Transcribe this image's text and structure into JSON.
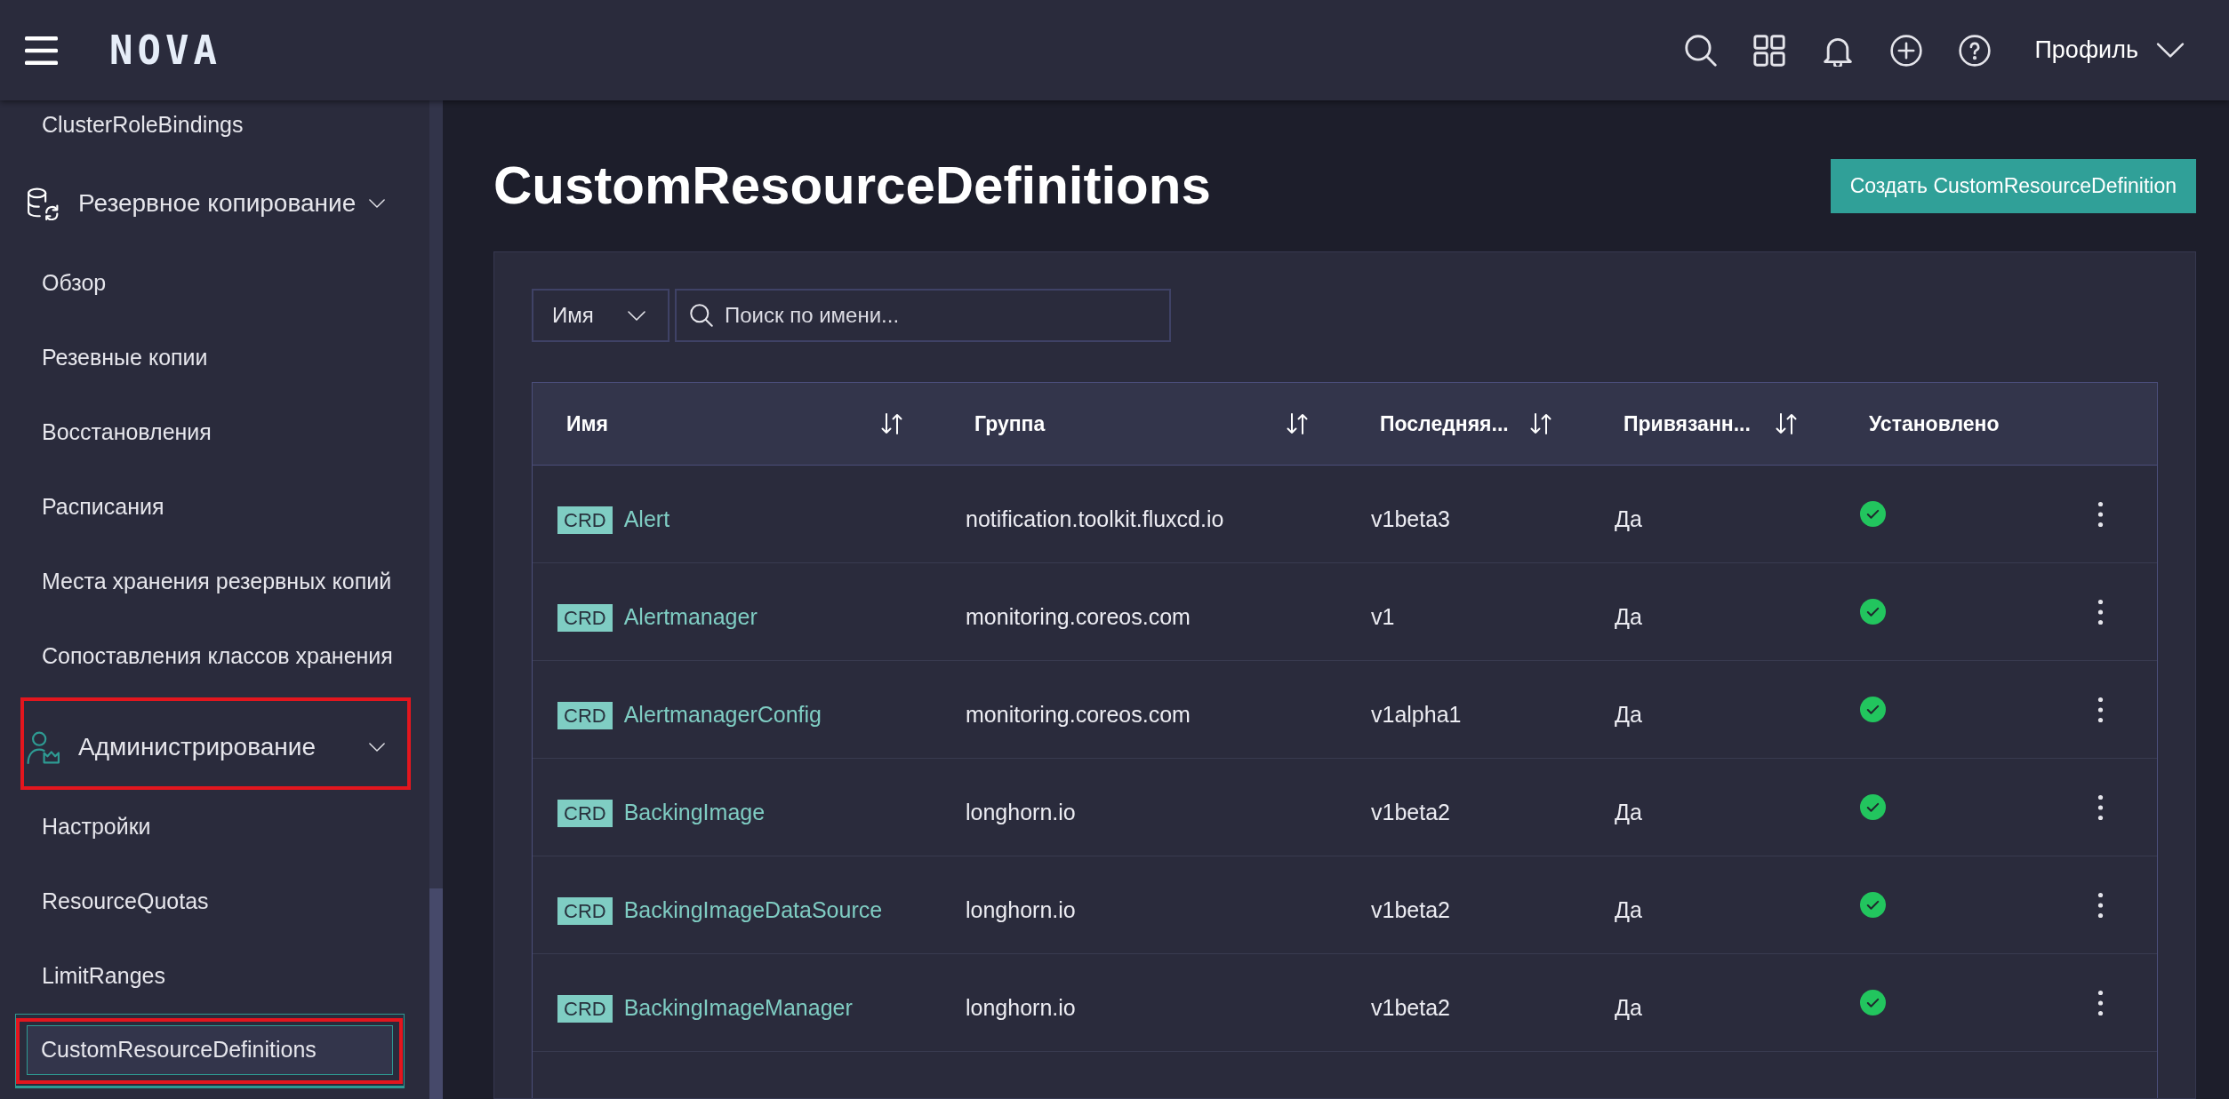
{
  "top_bar": {
    "logo": "NOVA",
    "profile": {
      "label": "Профиль"
    }
  },
  "sidebar": {
    "items": [
      {
        "kind": "link",
        "label": "ClusterRoleBindings",
        "selected": false,
        "highlighted": false
      },
      {
        "kind": "section",
        "label": "Резервное копирование",
        "expanded": true,
        "active": false,
        "highlighted": false,
        "children": [
          {
            "kind": "link",
            "label": "Обзор",
            "selected": false,
            "highlighted": false
          },
          {
            "kind": "link",
            "label": "Резевные копии",
            "selected": false,
            "highlighted": false
          },
          {
            "kind": "link",
            "label": "Восстановления",
            "selected": false,
            "highlighted": false
          },
          {
            "kind": "link",
            "label": "Расписания",
            "selected": false,
            "highlighted": false
          },
          {
            "kind": "link",
            "label": "Места хранения резервных копий",
            "selected": false,
            "highlighted": false
          },
          {
            "kind": "link",
            "label": "Сопоставления классов хранения",
            "selected": false,
            "highlighted": false
          }
        ]
      },
      {
        "kind": "section",
        "label": "Администрирование",
        "expanded": true,
        "active": true,
        "highlighted": true,
        "children": [
          {
            "kind": "link",
            "label": "Настройки",
            "selected": false,
            "highlighted": false
          },
          {
            "kind": "link",
            "label": "ResourceQuotas",
            "selected": false,
            "highlighted": false
          },
          {
            "kind": "link",
            "label": "LimitRanges",
            "selected": false,
            "highlighted": false
          },
          {
            "kind": "link",
            "label": "CustomResourceDefinitions",
            "selected": true,
            "highlighted": true
          }
        ]
      }
    ]
  },
  "page": {
    "title": "CustomResourceDefinitions",
    "create_button": {
      "label": "Создать CustomResourceDefinition"
    }
  },
  "filter": {
    "field": {
      "value": "Имя"
    },
    "search": {
      "placeholder": "Поиск по имени..."
    }
  },
  "table": {
    "columns": [
      {
        "label": "Имя",
        "sortable": true
      },
      {
        "label": "Группа",
        "sortable": true
      },
      {
        "label": "Последняя...",
        "sortable": true
      },
      {
        "label": "Привязанн...",
        "sortable": true
      },
      {
        "label": "Установлено",
        "sortable": false
      }
    ],
    "rows": [
      {
        "badge": "CRD",
        "name": "Alert",
        "group": "notification.toolkit.fluxcd.io",
        "version": "v1beta3",
        "bound": "Да",
        "installed": true
      },
      {
        "badge": "CRD",
        "name": "Alertmanager",
        "group": "monitoring.coreos.com",
        "version": "v1",
        "bound": "Да",
        "installed": true
      },
      {
        "badge": "CRD",
        "name": "AlertmanagerConfig",
        "group": "monitoring.coreos.com",
        "version": "v1alpha1",
        "bound": "Да",
        "installed": true
      },
      {
        "badge": "CRD",
        "name": "BackingImage",
        "group": "longhorn.io",
        "version": "v1beta2",
        "bound": "Да",
        "installed": true
      },
      {
        "badge": "CRD",
        "name": "BackingImageDataSource",
        "group": "longhorn.io",
        "version": "v1beta2",
        "bound": "Да",
        "installed": true
      },
      {
        "badge": "CRD",
        "name": "BackingImageManager",
        "group": "longhorn.io",
        "version": "v1beta2",
        "bound": "Да",
        "installed": true
      }
    ]
  }
}
